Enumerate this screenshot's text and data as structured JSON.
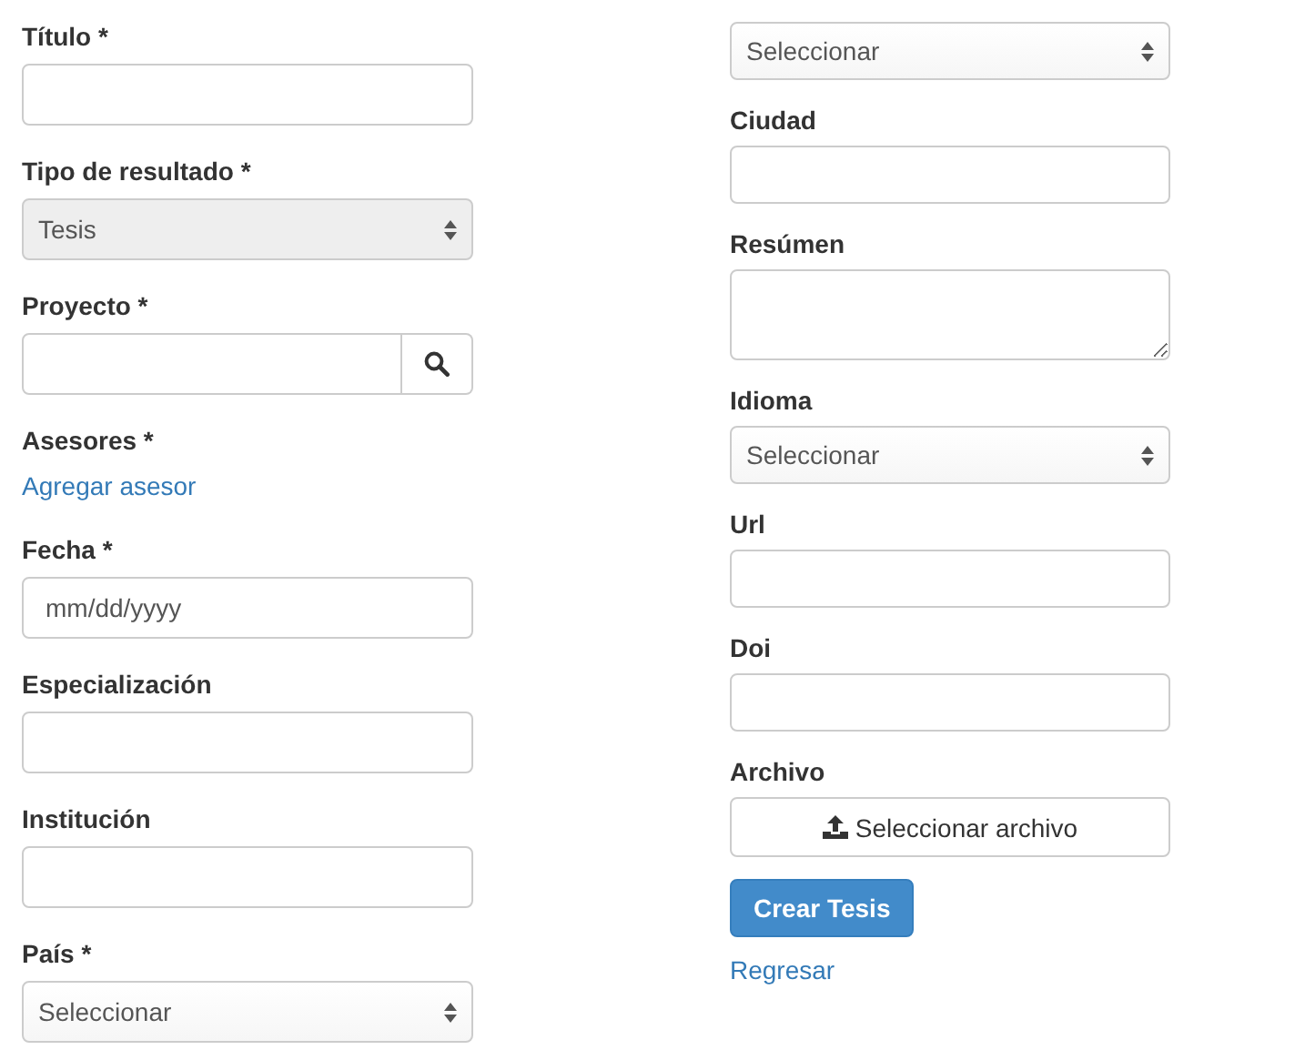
{
  "left_column": [
    {
      "kind": "text",
      "label": "Título *"
    },
    {
      "kind": "select",
      "label": "Tipo de resultado *",
      "value": "Tesis",
      "disabled": true
    },
    {
      "kind": "search",
      "label": "Proyecto *"
    },
    {
      "kind": "link",
      "label": "Asesores *",
      "link": "Agregar asesor"
    },
    {
      "kind": "text",
      "label": "Fecha *",
      "placeholder": "mm/dd/yyyy"
    },
    {
      "kind": "text",
      "label": "Especialización"
    },
    {
      "kind": "text",
      "label": "Institución"
    },
    {
      "kind": "select",
      "label": "País *",
      "value": "Seleccionar",
      "disabled": false
    }
  ],
  "right_column": [
    {
      "kind": "select",
      "value": "Seleccionar",
      "disabled": false
    },
    {
      "kind": "text",
      "label": "Ciudad"
    },
    {
      "kind": "textarea",
      "label": "Resúmen"
    },
    {
      "kind": "select",
      "label": "Idioma",
      "value": "Seleccionar",
      "disabled": false
    },
    {
      "kind": "text",
      "label": "Url"
    },
    {
      "kind": "text",
      "label": "Doi"
    },
    {
      "kind": "file",
      "label": "Archivo",
      "button": "Seleccionar archivo"
    }
  ],
  "submit_button": "Crear Tesis",
  "back_link": "Regresar"
}
